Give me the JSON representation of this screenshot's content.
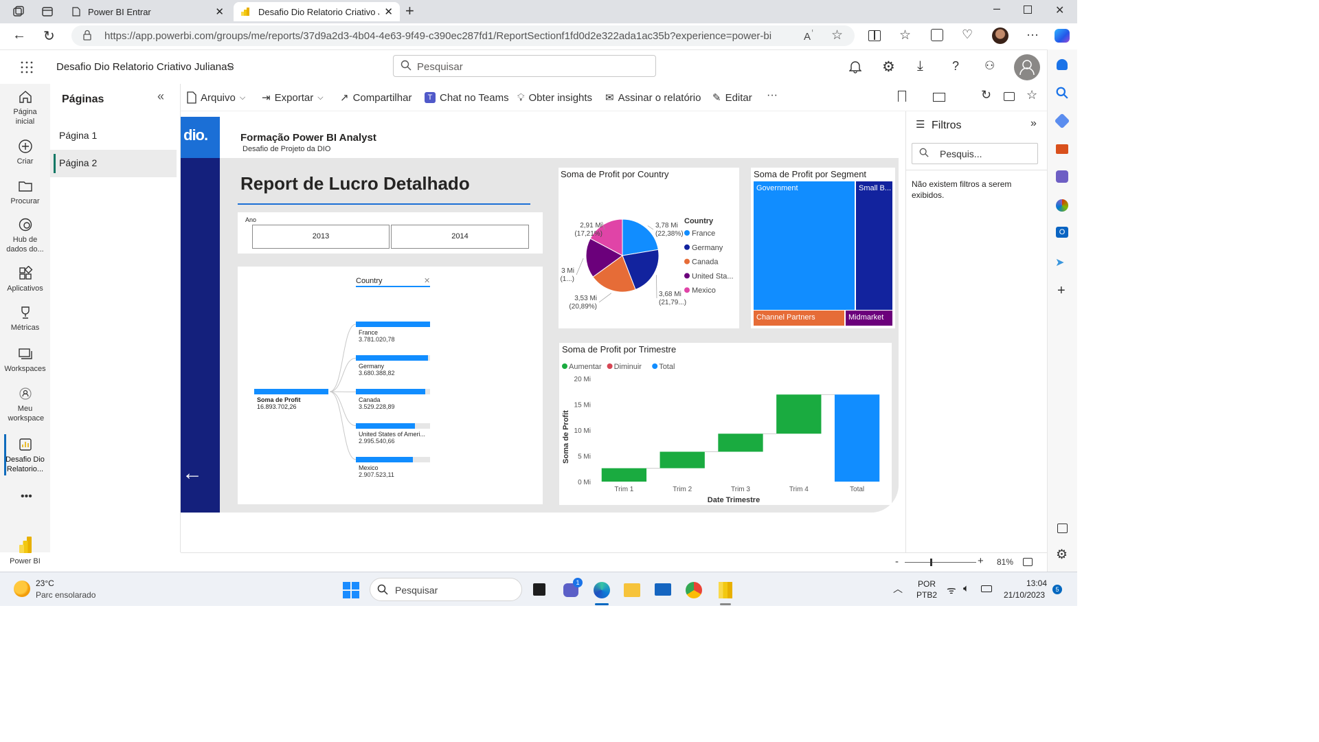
{
  "browser": {
    "tabs": [
      {
        "title": "Power BI Entrar"
      },
      {
        "title": "Desafio Dio Relatorio Criativo Jul"
      }
    ],
    "url": "https://app.powerbi.com/groups/me/reports/37d9a2d3-4b04-4e63-9f49-c390ec287fd1/ReportSectionf1fd0d2e322ada1ac35b?experience=power-bi"
  },
  "header": {
    "report_name": "Desafio Dio Relatorio Criativo JulianaS",
    "search_placeholder": "Pesquisar"
  },
  "nav": [
    {
      "label": "Página inicial",
      "icon": "home-icon"
    },
    {
      "label": "Criar",
      "icon": "plus-circle-icon"
    },
    {
      "label": "Procurar",
      "icon": "folder-icon"
    },
    {
      "label": "Hub de dados do...",
      "icon": "data-hub-icon"
    },
    {
      "label": "Aplicativos",
      "icon": "apps-icon"
    },
    {
      "label": "Métricas",
      "icon": "trophy-icon"
    },
    {
      "label": "Workspaces",
      "icon": "workspaces-icon"
    },
    {
      "label": "Meu workspace",
      "icon": "person-icon"
    },
    {
      "label": "Desafio Dio Relatorio...",
      "icon": "report-icon"
    },
    {
      "label": "Power BI",
      "icon": "powerbi-logo-icon"
    }
  ],
  "pages_panel": {
    "title": "Páginas",
    "pages": [
      "Página 1",
      "Página 2"
    ],
    "active": "Página 2"
  },
  "toolbar": {
    "file": "Arquivo",
    "export": "Exportar",
    "share": "Compartilhar",
    "teams": "Chat no Teams",
    "insights": "Obter insights",
    "subscribe": "Assinar o relatório",
    "edit": "Editar"
  },
  "filters": {
    "title": "Filtros",
    "search_placeholder": "Pesquis...",
    "empty_text": "Não existem filtros a serem exibidos."
  },
  "report": {
    "logo": "dio.",
    "heading": "Formação Power BI Analyst",
    "subheading": "Desafio de Projeto da DIO",
    "title": "Report de Lucro Detalhado",
    "slicer": {
      "label": "Ano",
      "options": [
        "2013",
        "2014"
      ]
    },
    "decomp": {
      "field_label": "Country",
      "root_label": "Soma de Profit",
      "root_value": "16.893.702,26",
      "items": [
        {
          "name": "France",
          "value": "3.781.020,78",
          "fraction": 1.0
        },
        {
          "name": "Germany",
          "value": "3.680.388,82",
          "fraction": 0.973
        },
        {
          "name": "Canada",
          "value": "3.529.228,89",
          "fraction": 0.933
        },
        {
          "name": "United States of Ameri...",
          "value": "2.995.540,66",
          "fraction": 0.792
        },
        {
          "name": "Mexico",
          "value": "2.907.523,11",
          "fraction": 0.769
        }
      ]
    }
  },
  "chart_data": [
    {
      "type": "pie",
      "title": "Soma de Profit por Country",
      "legend_title": "Country",
      "legend_position": "right",
      "slices": [
        {
          "name": "France",
          "value": 3.78,
          "label": "3,78 Mi",
          "pct": "(22,38%)",
          "color": "#118DFF"
        },
        {
          "name": "Germany",
          "value": 3.68,
          "label": "3,68 Mi",
          "pct": "(21,79...)",
          "color": "#12239E"
        },
        {
          "name": "Canada",
          "value": 3.53,
          "label": "3,53 Mi",
          "pct": "(20,89%)",
          "color": "#E66C37"
        },
        {
          "name": "United Sta...",
          "value": 3.0,
          "label": "3 Mi",
          "pct": "(1...)",
          "color": "#6B007B"
        },
        {
          "name": "Mexico",
          "value": 2.91,
          "label": "2,91 Mi",
          "pct": "(17,21%)",
          "color": "#E044A7"
        }
      ]
    },
    {
      "type": "treemap",
      "title": "Soma de Profit por Segment",
      "items": [
        {
          "name": "Government",
          "color": "#118DFF"
        },
        {
          "name": "Small B...",
          "color": "#12239E"
        },
        {
          "name": "Channel Partners",
          "color": "#E66C37"
        },
        {
          "name": "Midmarket",
          "color": "#6B007B"
        }
      ]
    },
    {
      "type": "waterfall",
      "title": "Soma de Profit por Trimestre",
      "xlabel": "Date Trimestre",
      "ylabel": "Soma de Profit",
      "legend": [
        {
          "name": "Aumentar",
          "color": "#1AAB40"
        },
        {
          "name": "Diminuir",
          "color": "#D64554"
        },
        {
          "name": "Total",
          "color": "#118DFF"
        }
      ],
      "yticks": [
        "0 Mi",
        "5 Mi",
        "10 Mi",
        "15 Mi",
        "20 Mi"
      ],
      "ylim": [
        0,
        20
      ],
      "categories": [
        "Trim 1",
        "Trim 2",
        "Trim 3",
        "Trim 4",
        "Total"
      ],
      "values": [
        2.6,
        3.2,
        3.5,
        7.6,
        16.9
      ]
    }
  ],
  "status": {
    "zoom": "81%"
  },
  "taskbar": {
    "temp": "23°C",
    "weather": "Parc ensolarado",
    "search": "Pesquisar",
    "lang1": "POR",
    "lang2": "PTB2",
    "time": "13:04",
    "date": "21/10/2023",
    "badge": "5"
  }
}
